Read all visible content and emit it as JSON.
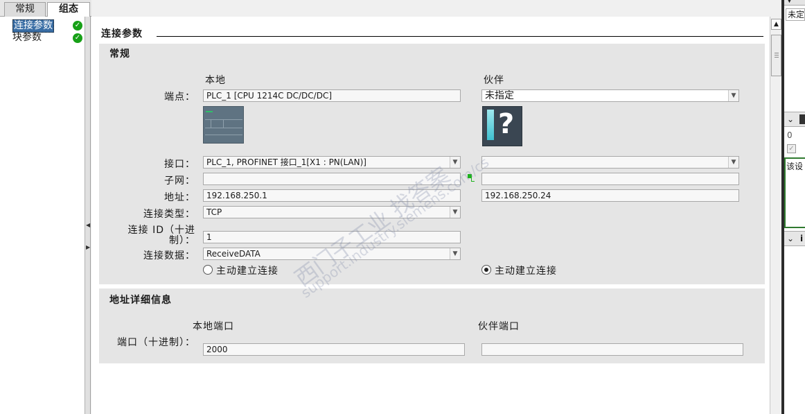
{
  "tabs": [
    {
      "label": "常规"
    },
    {
      "label": "组态"
    }
  ],
  "nav": {
    "items": [
      {
        "label": "连接参数",
        "status": "ok"
      },
      {
        "label": "块参数",
        "status": "ok"
      }
    ]
  },
  "section": {
    "title": "连接参数"
  },
  "general": {
    "title": "常规",
    "local_header": "本地",
    "partner_header": "伙伴",
    "endpoint_label": "端点：",
    "endpoint_local": "PLC_1 [CPU 1214C DC/DC/DC]",
    "endpoint_partner": "未指定",
    "interface_label": "接口：",
    "interface_local": "PLC_1, PROFINET 接口_1[X1 : PN(LAN)]",
    "interface_partner": "",
    "subnet_label": "子网：",
    "subnet_local": "",
    "subnet_partner": "",
    "address_label": "地址：",
    "address_local": "192.168.250.1",
    "address_partner": "192.168.250.24",
    "conn_type_label": "连接类型：",
    "conn_type_value": "TCP",
    "conn_id_label_1": "连接 ID（十进",
    "conn_id_label_2": "制）：",
    "conn_id_value": "1",
    "conn_data_label": "连接数据：",
    "conn_data_value": "ReceiveDATA",
    "local_active_label": "主动建立连接",
    "partner_active_label": "主动建立连接",
    "local_active_checked": false,
    "partner_active_checked": true
  },
  "address_details": {
    "title": "地址详细信息",
    "local_port_header": "本地端口",
    "partner_port_header": "伙伴端口",
    "port_label": "端口（十进制）：",
    "local_port_value": "2000",
    "partner_port_value": ""
  },
  "right_panel": {
    "text_top": "未定",
    "text_mid": "该设",
    "text_icon_a": "0",
    "text_icon_b": "i"
  },
  "watermark": {
    "line1": "西门子工业  找答案",
    "line2": "support.industry.siemens.com/cs"
  },
  "colors": {
    "accent_selection": "#3a6ea5",
    "ok_green": "#17a017",
    "group_bg": "#e5e5e5"
  }
}
